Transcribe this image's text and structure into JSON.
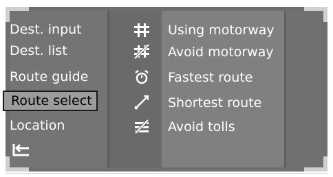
{
  "left_menu": {
    "items": [
      {
        "label": "Dest. input"
      },
      {
        "label": "Dest. list"
      },
      {
        "label": "Route guide"
      },
      {
        "label": "Route select"
      },
      {
        "label": "Location"
      }
    ],
    "selected_index": 3
  },
  "route_options": [
    {
      "label": "Using motorway",
      "icon": "motorway-icon"
    },
    {
      "label": "Avoid motorway",
      "icon": "avoid-motorway-icon"
    },
    {
      "label": "Fastest route",
      "icon": "stopwatch-icon"
    },
    {
      "label": "Shortest route",
      "icon": "shortest-route-icon"
    },
    {
      "label": "Avoid tolls",
      "icon": "avoid-tolls-icon"
    }
  ],
  "back_icon": "back-arrow-icon",
  "colors": {
    "panel": "#747474",
    "selected_bg": "#9c9c9c",
    "text": "#ffffff",
    "selected_text": "#000000"
  }
}
